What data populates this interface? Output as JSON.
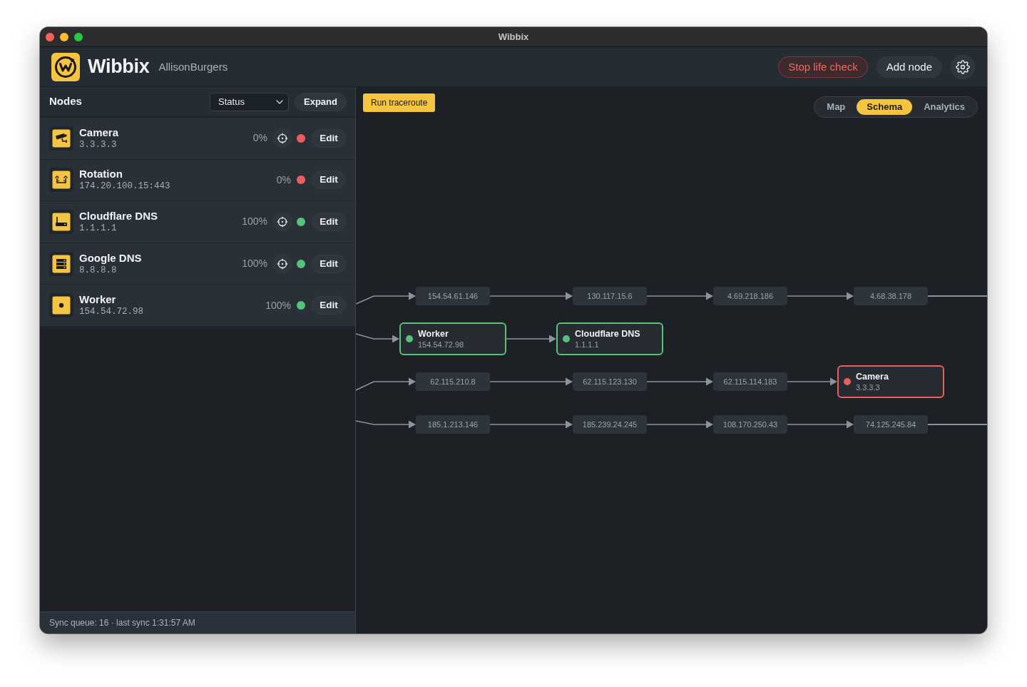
{
  "window": {
    "title": "Wibbix"
  },
  "header": {
    "app_name": "Wibbix",
    "account": "AllisonBurgers",
    "buttons": [
      {
        "label": "Stop life check",
        "kind": "danger"
      },
      {
        "label": "Add node",
        "kind": "secondary"
      }
    ]
  },
  "sidebar": {
    "title": "Nodes",
    "filter": {
      "value": "Status"
    },
    "expand_button": "Expand",
    "nodes": [
      {
        "kind": "camera",
        "name": "Camera",
        "address": "3.3.3.3",
        "uptime": "0%",
        "locate": true,
        "color": "#ec5f5b",
        "edit_button": "Edit"
      },
      {
        "kind": "rotation",
        "name": "Rotation",
        "address": "174.20.100.15:443",
        "uptime": "0%",
        "locate": false,
        "color": "#ec5f5b",
        "edit_button": "Edit"
      },
      {
        "kind": "router",
        "name": "Cloudflare DNS",
        "address": "1.1.1.1",
        "uptime": "100%",
        "locate": true,
        "color": "#57c27a",
        "edit_button": "Edit"
      },
      {
        "kind": "server",
        "name": "Google DNS",
        "address": "8.8.8.8",
        "uptime": "100%",
        "locate": true,
        "color": "#57c27a",
        "edit_button": "Edit"
      },
      {
        "kind": "worker",
        "name": "Worker",
        "address": "154.54.72.98",
        "uptime": "100%",
        "locate": false,
        "color": "#57c27a",
        "edit_button": "Edit"
      }
    ],
    "footer": "Sync queue: 16 · last sync 1:31:57 AM"
  },
  "main": {
    "run_button": "Run traceroute",
    "view_tabs": [
      {
        "label": "Map",
        "selected": false
      },
      {
        "label": "Schema",
        "selected": true
      },
      {
        "label": "Analytics",
        "selected": false
      }
    ],
    "schema": {
      "routes": [
        {
          "continues": true,
          "steps": [
            {
              "kind": "hop",
              "address": "154.54.61.146"
            },
            {
              "kind": "hop",
              "address": "130.117.15.6"
            },
            {
              "kind": "hop",
              "address": "4.69.218.186"
            },
            {
              "kind": "hop",
              "address": "4.68.38.178"
            }
          ]
        },
        {
          "continues": false,
          "steps": [
            {
              "kind": "node",
              "name": "Worker",
              "address": "154.54.72.98",
              "color": "#57c27a"
            },
            {
              "kind": "node",
              "name": "Cloudflare DNS",
              "address": "1.1.1.1",
              "color": "#57c27a"
            }
          ]
        },
        {
          "continues": false,
          "steps": [
            {
              "kind": "hop",
              "address": "62.115.210.8"
            },
            {
              "kind": "hop",
              "address": "62.115.123.130"
            },
            {
              "kind": "hop",
              "address": "62.115.114.183"
            },
            {
              "kind": "node",
              "name": "Camera",
              "address": "3.3.3.3",
              "color": "#ec5f5b"
            }
          ]
        },
        {
          "continues": true,
          "steps": [
            {
              "kind": "hop",
              "address": "185.1.213.146"
            },
            {
              "kind": "hop",
              "address": "185.239.24.245"
            },
            {
              "kind": "hop",
              "address": "108.170.250.43"
            },
            {
              "kind": "hop",
              "address": "74.125.245.84"
            }
          ]
        }
      ]
    }
  }
}
